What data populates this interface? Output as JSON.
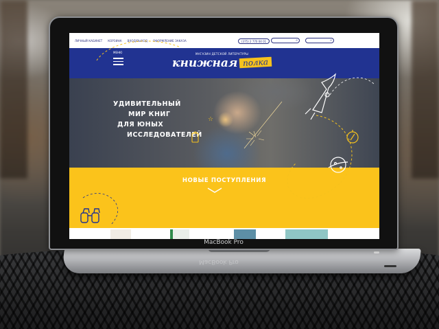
{
  "device_label": "MacBook Pro",
  "device_label_reflection": "MacBook Pro",
  "site": {
    "top_nav": [
      "Личный кабинет",
      "Корзина",
      "Вход/Выход",
      "Оформление заказа"
    ],
    "phone": "(375) 2 770 04 01",
    "header": {
      "menu_label": "МЕНЮ",
      "tagline": "МАГАЗИН ДЕТСКОЙ ЛИТЕРАТУРЫ",
      "logo_main": "книжная",
      "logo_accent": "полка"
    },
    "hero": {
      "lines": [
        "УДИВИТЕЛЬНЫЙ",
        "МИР КНИГ",
        "ДЛЯ ЮНЫХ",
        "ИССЛЕДОВАТЕЛЕЙ"
      ]
    },
    "new_arrivals": "НОВЫЕ ПОСТУПЛЕНИЯ",
    "icons": [
      "rocket-icon",
      "compass-icon",
      "planet-icon",
      "binoculars-icon",
      "lantern-icon",
      "star-icon",
      "search-icon",
      "chevron-down-icon",
      "burger-icon"
    ]
  },
  "colors": {
    "brand_blue": "#213391",
    "brand_yellow": "#fbc31b"
  }
}
